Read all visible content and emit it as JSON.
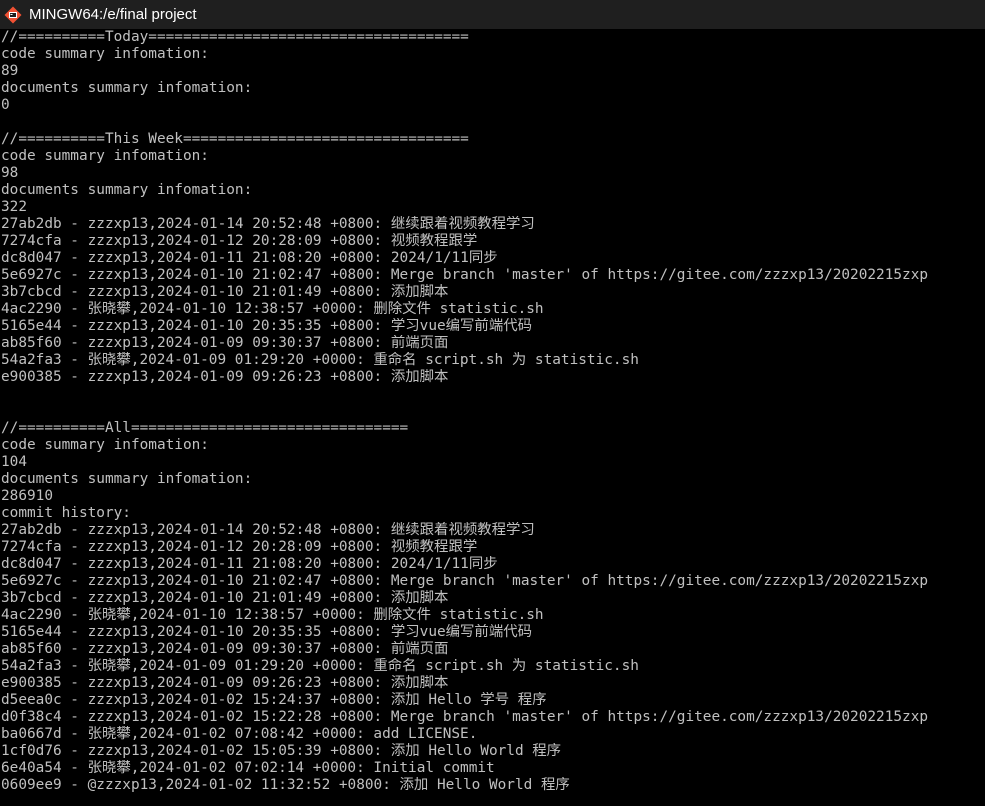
{
  "window": {
    "title": "MINGW64:/e/final project",
    "icon": "git-bash-icon",
    "title_bg": "#1f1f1f",
    "terminal_bg": "#000000",
    "terminal_fg": "#c0c0c0"
  },
  "terminal": {
    "lines": [
      "//==========Today=====================================",
      "code summary infomation:",
      "89",
      "documents summary infomation:",
      "0",
      "",
      "//==========This Week=================================",
      "code summary infomation:",
      "98",
      "documents summary infomation:",
      "322",
      "27ab2db - zzzxp13,2024-01-14 20:52:48 +0800: 继续跟着视频教程学习",
      "7274cfa - zzzxp13,2024-01-12 20:28:09 +0800: 视频教程跟学",
      "dc8d047 - zzzxp13,2024-01-11 21:08:20 +0800: 2024/1/11同步",
      "5e6927c - zzzxp13,2024-01-10 21:02:47 +0800: Merge branch 'master' of https://gitee.com/zzzxp13/20202215zxp",
      "3b7cbcd - zzzxp13,2024-01-10 21:01:49 +0800: 添加脚本",
      "4ac2290 - 张晓攀,2024-01-10 12:38:57 +0000: 删除文件 statistic.sh",
      "5165e44 - zzzxp13,2024-01-10 20:35:35 +0800: 学习vue编写前端代码",
      "ab85f60 - zzzxp13,2024-01-09 09:30:37 +0800: 前端页面",
      "54a2fa3 - 张晓攀,2024-01-09 01:29:20 +0000: 重命名 script.sh 为 statistic.sh",
      "e900385 - zzzxp13,2024-01-09 09:26:23 +0800: 添加脚本",
      "",
      "",
      "//==========All================================",
      "code summary infomation:",
      "104",
      "documents summary infomation:",
      "286910",
      "commit history:",
      "27ab2db - zzzxp13,2024-01-14 20:52:48 +0800: 继续跟着视频教程学习",
      "7274cfa - zzzxp13,2024-01-12 20:28:09 +0800: 视频教程跟学",
      "dc8d047 - zzzxp13,2024-01-11 21:08:20 +0800: 2024/1/11同步",
      "5e6927c - zzzxp13,2024-01-10 21:02:47 +0800: Merge branch 'master' of https://gitee.com/zzzxp13/20202215zxp",
      "3b7cbcd - zzzxp13,2024-01-10 21:01:49 +0800: 添加脚本",
      "4ac2290 - 张晓攀,2024-01-10 12:38:57 +0000: 删除文件 statistic.sh",
      "5165e44 - zzzxp13,2024-01-10 20:35:35 +0800: 学习vue编写前端代码",
      "ab85f60 - zzzxp13,2024-01-09 09:30:37 +0800: 前端页面",
      "54a2fa3 - 张晓攀,2024-01-09 01:29:20 +0000: 重命名 script.sh 为 statistic.sh",
      "e900385 - zzzxp13,2024-01-09 09:26:23 +0800: 添加脚本",
      "d5eea0c - zzzxp13,2024-01-02 15:24:37 +0800: 添加 Hello 学号 程序",
      "d0f38c4 - zzzxp13,2024-01-02 15:22:28 +0800: Merge branch 'master' of https://gitee.com/zzzxp13/20202215zxp",
      "ba0667d - 张晓攀,2024-01-02 07:08:42 +0000: add LICENSE.",
      "1cf0d76 - zzzxp13,2024-01-02 15:05:39 +0800: 添加 Hello World 程序",
      "6e40a54 - 张晓攀,2024-01-02 07:02:14 +0000: Initial commit",
      "0609ee9 - @zzzxp13,2024-01-02 11:32:52 +0800: 添加 Hello World 程序"
    ]
  }
}
